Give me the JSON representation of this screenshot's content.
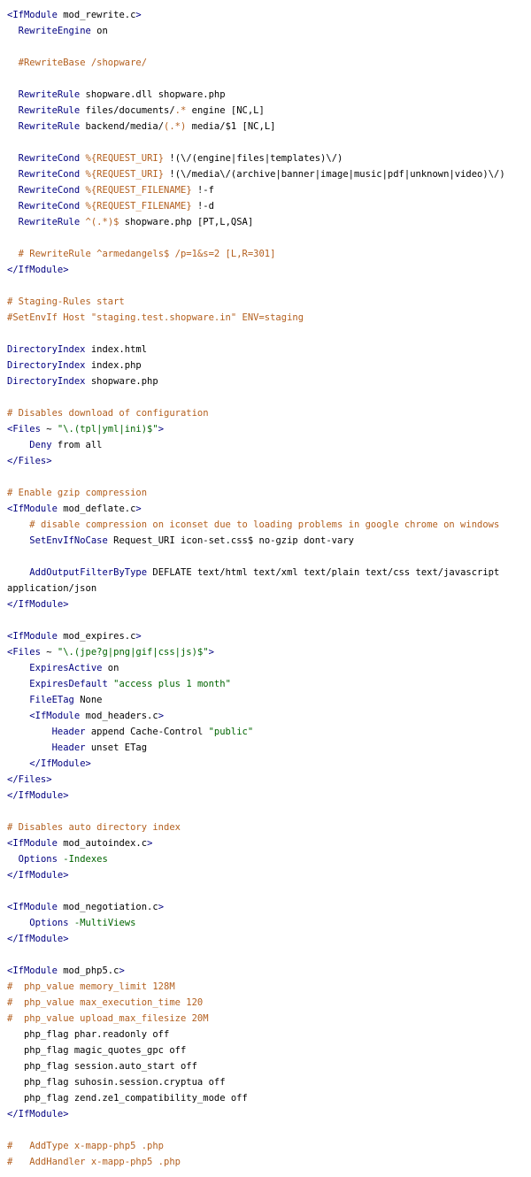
{
  "colors": {
    "tag": "#000080",
    "directive": "#000080",
    "comment": "#b35f1e",
    "string": "#006400",
    "variable": "#b35f1e",
    "text": "#000000",
    "background": "#ffffff"
  },
  "lines": [
    [
      {
        "c": "tag",
        "t": "<IfModule"
      },
      {
        "c": "plain",
        "t": " mod_rewrite.c"
      },
      {
        "c": "tag",
        "t": ">"
      }
    ],
    [
      {
        "c": "plain",
        "t": "  "
      },
      {
        "c": "dir",
        "t": "RewriteEngine"
      },
      {
        "c": "plain",
        "t": " on"
      }
    ],
    [],
    [
      {
        "c": "plain",
        "t": "  "
      },
      {
        "c": "cmt",
        "t": "#RewriteBase /shopware/"
      }
    ],
    [],
    [
      {
        "c": "plain",
        "t": "  "
      },
      {
        "c": "dir",
        "t": "RewriteRule"
      },
      {
        "c": "plain",
        "t": " shopware.dll shopware.php"
      }
    ],
    [
      {
        "c": "plain",
        "t": "  "
      },
      {
        "c": "dir",
        "t": "RewriteRule"
      },
      {
        "c": "plain",
        "t": " files/documents/"
      },
      {
        "c": "var",
        "t": ".*"
      },
      {
        "c": "plain",
        "t": " engine [NC,L]"
      }
    ],
    [
      {
        "c": "plain",
        "t": "  "
      },
      {
        "c": "dir",
        "t": "RewriteRule"
      },
      {
        "c": "plain",
        "t": " backend/media/"
      },
      {
        "c": "var",
        "t": "(.*)"
      },
      {
        "c": "plain",
        "t": " media/$1 [NC,L]"
      }
    ],
    [],
    [
      {
        "c": "plain",
        "t": "  "
      },
      {
        "c": "dir",
        "t": "RewriteCond"
      },
      {
        "c": "plain",
        "t": " "
      },
      {
        "c": "var",
        "t": "%{REQUEST_URI}"
      },
      {
        "c": "plain",
        "t": " !(\\/(engine|files|templates)\\/)"
      }
    ],
    [
      {
        "c": "plain",
        "t": "  "
      },
      {
        "c": "dir",
        "t": "RewriteCond"
      },
      {
        "c": "plain",
        "t": " "
      },
      {
        "c": "var",
        "t": "%{REQUEST_URI}"
      },
      {
        "c": "plain",
        "t": " !(\\/media\\/(archive|banner|image|music|pdf|unknown|video)\\/)"
      }
    ],
    [
      {
        "c": "plain",
        "t": "  "
      },
      {
        "c": "dir",
        "t": "RewriteCond"
      },
      {
        "c": "plain",
        "t": " "
      },
      {
        "c": "var",
        "t": "%{REQUEST_FILENAME}"
      },
      {
        "c": "plain",
        "t": " !-f"
      }
    ],
    [
      {
        "c": "plain",
        "t": "  "
      },
      {
        "c": "dir",
        "t": "RewriteCond"
      },
      {
        "c": "plain",
        "t": " "
      },
      {
        "c": "var",
        "t": "%{REQUEST_FILENAME}"
      },
      {
        "c": "plain",
        "t": " !-d"
      }
    ],
    [
      {
        "c": "plain",
        "t": "  "
      },
      {
        "c": "dir",
        "t": "RewriteRule"
      },
      {
        "c": "plain",
        "t": " "
      },
      {
        "c": "var",
        "t": "^(.*)$"
      },
      {
        "c": "plain",
        "t": " shopware.php [PT,L,QSA]"
      }
    ],
    [],
    [
      {
        "c": "plain",
        "t": "  "
      },
      {
        "c": "cmt",
        "t": "# RewriteRule ^armedangels$ /p=1&s=2 [L,R=301]"
      }
    ],
    [
      {
        "c": "tag",
        "t": "</IfModule>"
      }
    ],
    [],
    [
      {
        "c": "cmt",
        "t": "# Staging-Rules start"
      }
    ],
    [
      {
        "c": "cmt",
        "t": "#SetEnvIf Host \"staging.test.shopware.in\" ENV=staging"
      }
    ],
    [],
    [
      {
        "c": "dir",
        "t": "DirectoryIndex"
      },
      {
        "c": "plain",
        "t": " index.html"
      }
    ],
    [
      {
        "c": "dir",
        "t": "DirectoryIndex"
      },
      {
        "c": "plain",
        "t": " index.php"
      }
    ],
    [
      {
        "c": "dir",
        "t": "DirectoryIndex"
      },
      {
        "c": "plain",
        "t": " shopware.php"
      }
    ],
    [],
    [
      {
        "c": "cmt",
        "t": "# Disables download of configuration"
      }
    ],
    [
      {
        "c": "tag",
        "t": "<Files"
      },
      {
        "c": "plain",
        "t": " ~ "
      },
      {
        "c": "str",
        "t": "\"\\.(tpl|yml|ini)$\""
      },
      {
        "c": "tag",
        "t": ">"
      }
    ],
    [
      {
        "c": "plain",
        "t": "    "
      },
      {
        "c": "dir",
        "t": "Deny"
      },
      {
        "c": "plain",
        "t": " from all"
      }
    ],
    [
      {
        "c": "tag",
        "t": "</Files>"
      }
    ],
    [],
    [
      {
        "c": "cmt",
        "t": "# Enable gzip compression"
      }
    ],
    [
      {
        "c": "tag",
        "t": "<IfModule"
      },
      {
        "c": "plain",
        "t": " mod_deflate.c"
      },
      {
        "c": "tag",
        "t": ">"
      }
    ],
    [
      {
        "c": "plain",
        "t": "    "
      },
      {
        "c": "cmt",
        "t": "# disable compression on iconset due to loading problems in google chrome on windows"
      }
    ],
    [
      {
        "c": "plain",
        "t": "    "
      },
      {
        "c": "dir",
        "t": "SetEnvIfNoCase"
      },
      {
        "c": "plain",
        "t": " Request_URI icon-set.css$ no-gzip dont-vary"
      }
    ],
    [],
    [
      {
        "c": "plain",
        "t": "    "
      },
      {
        "c": "dir",
        "t": "AddOutputFilterByType"
      },
      {
        "c": "plain",
        "t": " DEFLATE text/html text/xml text/plain text/css text/javascript"
      }
    ],
    [
      {
        "c": "plain",
        "t": "application/json"
      }
    ],
    [
      {
        "c": "tag",
        "t": "</IfModule>"
      }
    ],
    [],
    [
      {
        "c": "tag",
        "t": "<IfModule"
      },
      {
        "c": "plain",
        "t": " mod_expires.c"
      },
      {
        "c": "tag",
        "t": ">"
      }
    ],
    [
      {
        "c": "tag",
        "t": "<Files"
      },
      {
        "c": "plain",
        "t": " ~ "
      },
      {
        "c": "str",
        "t": "\"\\.(jpe?g|png|gif|css|js)$\""
      },
      {
        "c": "tag",
        "t": ">"
      }
    ],
    [
      {
        "c": "plain",
        "t": "    "
      },
      {
        "c": "dir",
        "t": "ExpiresActive"
      },
      {
        "c": "plain",
        "t": " on"
      }
    ],
    [
      {
        "c": "plain",
        "t": "    "
      },
      {
        "c": "dir",
        "t": "ExpiresDefault"
      },
      {
        "c": "plain",
        "t": " "
      },
      {
        "c": "str",
        "t": "\"access plus 1 month\""
      }
    ],
    [
      {
        "c": "plain",
        "t": "    "
      },
      {
        "c": "dir",
        "t": "FileETag"
      },
      {
        "c": "plain",
        "t": " None"
      }
    ],
    [
      {
        "c": "plain",
        "t": "    "
      },
      {
        "c": "tag",
        "t": "<IfModule"
      },
      {
        "c": "plain",
        "t": " mod_headers.c"
      },
      {
        "c": "tag",
        "t": ">"
      }
    ],
    [
      {
        "c": "plain",
        "t": "        "
      },
      {
        "c": "dir",
        "t": "Header"
      },
      {
        "c": "plain",
        "t": " append Cache-Control "
      },
      {
        "c": "str",
        "t": "\"public\""
      }
    ],
    [
      {
        "c": "plain",
        "t": "        "
      },
      {
        "c": "dir",
        "t": "Header"
      },
      {
        "c": "plain",
        "t": " unset ETag"
      }
    ],
    [
      {
        "c": "plain",
        "t": "    "
      },
      {
        "c": "tag",
        "t": "</IfModule>"
      }
    ],
    [
      {
        "c": "tag",
        "t": "</Files>"
      }
    ],
    [
      {
        "c": "tag",
        "t": "</IfModule>"
      }
    ],
    [],
    [
      {
        "c": "cmt",
        "t": "# Disables auto directory index"
      }
    ],
    [
      {
        "c": "tag",
        "t": "<IfModule"
      },
      {
        "c": "plain",
        "t": " mod_autoindex.c"
      },
      {
        "c": "tag",
        "t": ">"
      }
    ],
    [
      {
        "c": "plain",
        "t": "  "
      },
      {
        "c": "dir",
        "t": "Options"
      },
      {
        "c": "plain",
        "t": " "
      },
      {
        "c": "str",
        "t": "-Indexes"
      }
    ],
    [
      {
        "c": "tag",
        "t": "</IfModule>"
      }
    ],
    [],
    [
      {
        "c": "tag",
        "t": "<IfModule"
      },
      {
        "c": "plain",
        "t": " mod_negotiation.c"
      },
      {
        "c": "tag",
        "t": ">"
      }
    ],
    [
      {
        "c": "plain",
        "t": "    "
      },
      {
        "c": "dir",
        "t": "Options"
      },
      {
        "c": "plain",
        "t": " "
      },
      {
        "c": "str",
        "t": "-MultiViews"
      }
    ],
    [
      {
        "c": "tag",
        "t": "</IfModule>"
      }
    ],
    [],
    [
      {
        "c": "tag",
        "t": "<IfModule"
      },
      {
        "c": "plain",
        "t": " mod_php5.c"
      },
      {
        "c": "tag",
        "t": ">"
      }
    ],
    [
      {
        "c": "cmt",
        "t": "#  php_value memory_limit 128M"
      }
    ],
    [
      {
        "c": "cmt",
        "t": "#  php_value max_execution_time 120"
      }
    ],
    [
      {
        "c": "cmt",
        "t": "#  php_value upload_max_filesize 20M"
      }
    ],
    [
      {
        "c": "plain",
        "t": "   php_flag phar.readonly off"
      }
    ],
    [
      {
        "c": "plain",
        "t": "   php_flag magic_quotes_gpc off"
      }
    ],
    [
      {
        "c": "plain",
        "t": "   php_flag session.auto_start off"
      }
    ],
    [
      {
        "c": "plain",
        "t": "   php_flag suhosin.session.cryptua off"
      }
    ],
    [
      {
        "c": "plain",
        "t": "   php_flag zend.ze1_compatibility_mode off"
      }
    ],
    [
      {
        "c": "tag",
        "t": "</IfModule>"
      }
    ],
    [],
    [
      {
        "c": "cmt",
        "t": "#   AddType x-mapp-php5 .php"
      }
    ],
    [
      {
        "c": "cmt",
        "t": "#   AddHandler x-mapp-php5 .php"
      }
    ]
  ]
}
